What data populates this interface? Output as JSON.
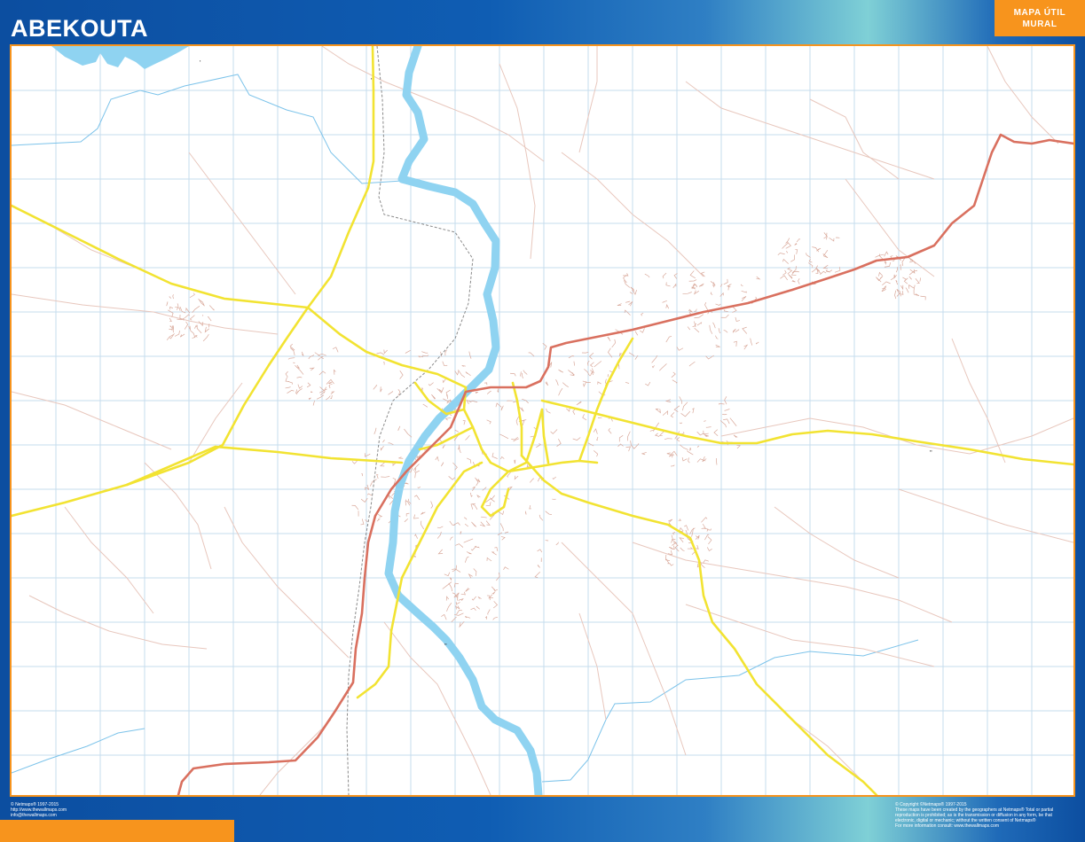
{
  "map": {
    "title": "ABEKOUTA",
    "badge": [
      "MAPA ÚTIL",
      "MURAL"
    ],
    "colors": {
      "frame": "#0d55a8",
      "accent": "#f7941d",
      "water": "#8fd3f1",
      "major_road": "#f2e332",
      "primary_road": "#d9705f",
      "minor_road": "#e8c7bd",
      "grid": "#c6dcee",
      "railway": "#8a8a8a"
    },
    "features": [
      "river",
      "reservoir",
      "streams",
      "primary-road",
      "major-roads",
      "minor-roads",
      "railway",
      "street-grid"
    ]
  },
  "footer": {
    "left": [
      "© Netmaps® 1997-2015",
      "http://www.thewallmaps.com",
      "info@thewallmaps.com"
    ],
    "right": [
      "© Copyright ©Netmaps® 1997-2015",
      "These maps have been created by the geographers at Netmaps® Total or partial",
      "reproduction is prohibited; as is the transmission or diffusion in any form, be that",
      "electronic, digital or mechanic; without the written consent of Netmaps®",
      "For more information consult: www.thewallmaps.com"
    ]
  }
}
